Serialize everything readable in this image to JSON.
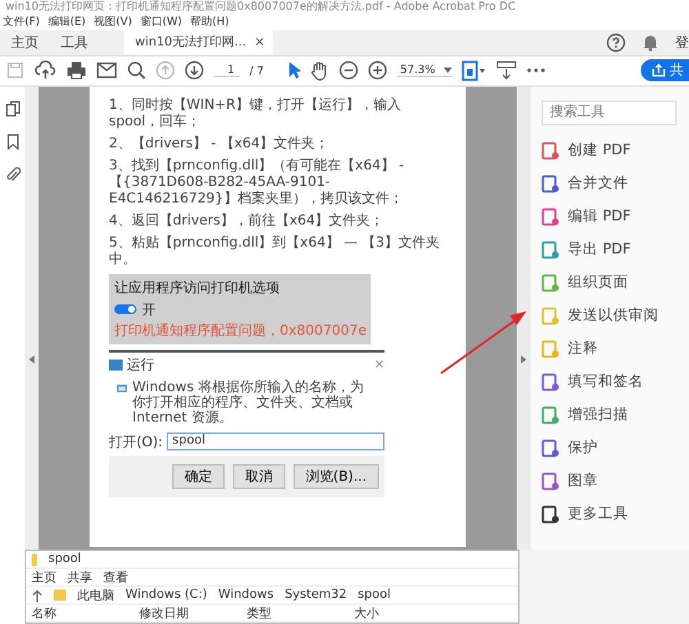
{
  "window": {
    "title": "win10无法打印网页：打印机通知程序配置问题0x8007007e的解决方法.pdf - Adobe Acrobat Pro DC"
  },
  "menu": [
    "文件(F)",
    "编辑(E)",
    "视图(V)",
    "窗口(W)",
    "帮助(H)"
  ],
  "tabs": [
    {
      "label": "主页",
      "selected": false
    },
    {
      "label": "工具",
      "selected": false
    },
    {
      "label": "win10无法打印网...",
      "selected": true,
      "close": "×"
    }
  ],
  "account": {
    "label": "登"
  },
  "toolbar": {
    "page": "1",
    "page_total": "/ 7",
    "zoom": "57.3%",
    "share": "共"
  },
  "document": {
    "steps": [
      "1、同时按【WIN+R】键，打开【运行】，输入 spool，回车；",
      "2、【drivers】 - 【x64】文件夹；",
      "3、找到【prnconfig.dll】（有可能在【x64】 - 【{3871D608-B282-45AA-9101-E4C146216729}】档案夹里），拷贝该文件；",
      "4、返回【drivers】，前往【x64】文件夹；",
      "5、粘贴【prnconfig.dll】到【x64】 — 【3】文件夹中。"
    ],
    "screenshot": {
      "heading": "让应用程序访问打印机选项",
      "toggle_on": true,
      "toggle_label": "开",
      "error": "打印机通知程序配置问题，0x8007007e"
    },
    "run_dialog": {
      "title": "运行",
      "close": "×",
      "message": "Windows 将根据你所输入的名称，为你打开相应的程序、文件夹、文档或 Internet 资源。",
      "open_label": "打开(O):",
      "value": "spool",
      "buttons": [
        "确定",
        "取消",
        "浏览(B)..."
      ]
    }
  },
  "tools_panel": {
    "search": {
      "placeholder": "搜索工具"
    },
    "items": [
      {
        "label": "创建 PDF",
        "color": "#e0525a"
      },
      {
        "label": "合并文件",
        "color": "#4f5bd5"
      },
      {
        "label": "编辑 PDF",
        "color": "#d9438f"
      },
      {
        "label": "导出 PDF",
        "color": "#2a9fa8"
      },
      {
        "label": "组织页面",
        "color": "#5fb844"
      },
      {
        "label": "发送以供审阅",
        "color": "#e6c02b"
      },
      {
        "label": "注释",
        "color": "#e8b51f"
      },
      {
        "label": "填写和签名",
        "color": "#7a5cd6"
      },
      {
        "label": "增强扫描",
        "color": "#3bb067"
      },
      {
        "label": "保护",
        "color": "#5c5fd1"
      },
      {
        "label": "图章",
        "color": "#9a55c9"
      },
      {
        "label": "更多工具",
        "color": "#333333"
      }
    ]
  },
  "explorer": {
    "title": "spool",
    "ribbon_tabs": [
      "主页",
      "共享",
      "查看"
    ],
    "path": [
      "此电脑",
      "Windows (C:)",
      "Windows",
      "System32",
      "spool"
    ],
    "columns": [
      "名称",
      "修改日期",
      "类型",
      "大小"
    ]
  }
}
